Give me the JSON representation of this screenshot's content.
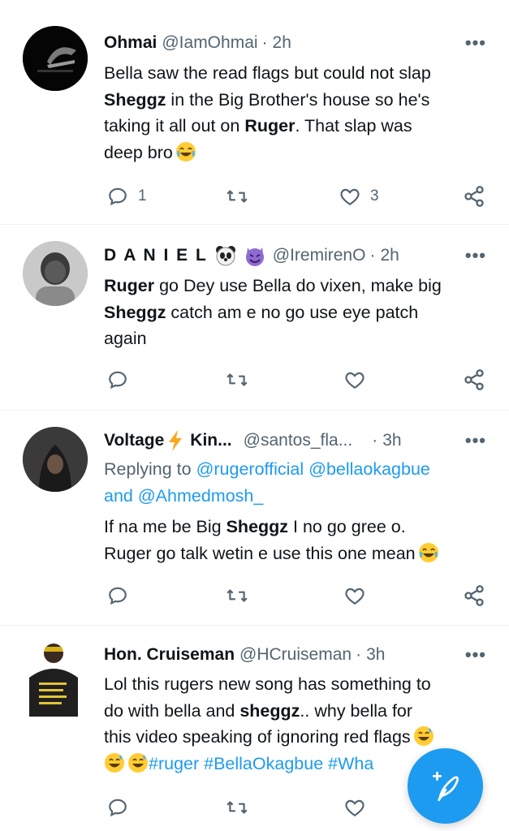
{
  "tweets": [
    {
      "name": "Ohmai",
      "handle": "@IamOhmai",
      "time": "2h",
      "lines": [
        {
          "a": "Bella saw the read flags but could not slap"
        },
        {
          "b": "Sheggz",
          "a": " in the Big Brother's house so he's"
        },
        {
          "pre": "taking it all out on ",
          "b": "Ruger",
          "a": ". That slap was"
        },
        {
          "a": "deep bro"
        }
      ],
      "reply_count": "1",
      "like_count": "3"
    },
    {
      "name": "D A N I E L",
      "handle": "@IremirenO",
      "time": "2h",
      "lines": [
        {
          "b": "Ruger",
          "a": " go Dey use Bella do vixen, make big"
        },
        {
          "b": "Sheggz",
          "a": " catch am e no go use eye patch"
        },
        {
          "a": "again"
        }
      ]
    },
    {
      "name": "Voltage",
      "name_suffix": "Kin...",
      "handle": "@santos_fla...",
      "time": "3h",
      "replying_to_label": "Replying to",
      "replying_to_user1": "@rugerofficial",
      "replying_to_user2": "@bellaokagbue",
      "replying_and": "and",
      "replying_to_user3": "@Ahmedmosh_",
      "lines": [
        {
          "pre": "If na me be Big ",
          "b": "Sheggz",
          "a": " I no go gree o."
        },
        {
          "a": "Ruger go talk wetin e use this one mean"
        }
      ]
    },
    {
      "name": "Hon. Cruiseman",
      "handle": "@HCruiseman",
      "time": "3h",
      "lines": [
        {
          "a": "Lol this rugers new song has something to"
        },
        {
          "pre": "do with bella and ",
          "b": "sheggz",
          "a": ".. why bella for"
        },
        {
          "a": "this video speaking of ignoring red flags"
        }
      ],
      "hashtags": "#ruger #BellaOkagbue #Wha"
    }
  ],
  "ui": {
    "more": "•••",
    "dot": "·",
    "accent": "#1d9bf0",
    "icons": [
      "reply-icon",
      "retweet-icon",
      "like-icon",
      "share-icon",
      "compose-tweet-icon",
      "more-options-icon"
    ]
  }
}
